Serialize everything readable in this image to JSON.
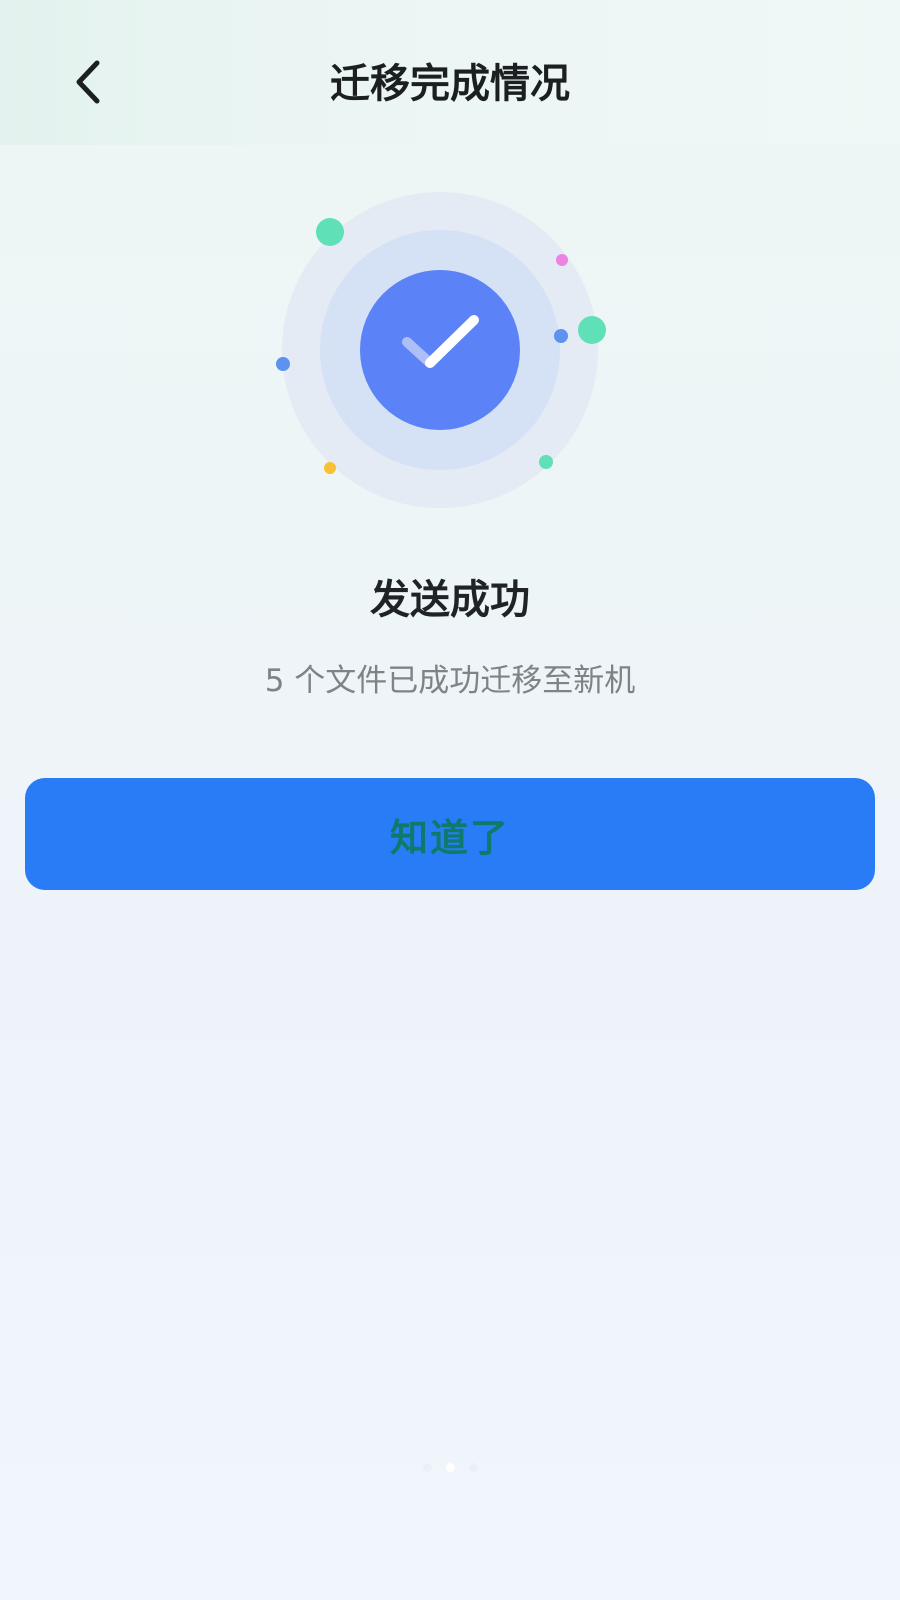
{
  "header": {
    "title": "迁移完成情况",
    "back_icon": "chevron-left-icon"
  },
  "illustration": {
    "icon": "check-icon",
    "colors": {
      "check_circle": "#5b82f6",
      "inner_ring": "#d3e0f6",
      "outer_ring": "#e3ebf5",
      "confetti_green": "#5fe0b6",
      "confetti_blue": "#5b93ee",
      "confetti_pink": "#ea84e0",
      "confetti_yellow": "#f6c132"
    }
  },
  "result": {
    "title": "发送成功",
    "description": "5 个文件已成功迁移至新机"
  },
  "actions": {
    "ok_label": "知道了",
    "ok_color": "#2a7cf6"
  }
}
